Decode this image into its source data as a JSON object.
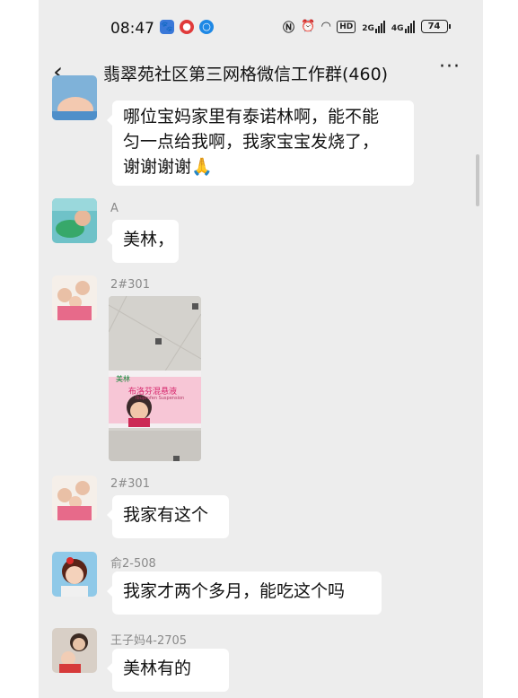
{
  "status_bar": {
    "time": "08:47",
    "battery": "74",
    "app_icons": [
      "baidu-icon",
      "weibo-icon",
      "qq-browser-icon"
    ],
    "signal_1_label": "2G",
    "signal_2_label": "4G",
    "hd_label": "HD"
  },
  "header": {
    "title": "翡翠苑社区第三网格微信工作群(460)",
    "back_icon": "chevron-left-icon",
    "more_icon": "more-icon"
  },
  "messages": [
    {
      "sender": "",
      "lines": [
        "哪位宝妈家里有泰诺林啊，能不能",
        "匀一点给我啊，我家宝宝发烧了，",
        "谢谢谢谢🙏"
      ]
    },
    {
      "sender": "A",
      "lines": [
        "美林，"
      ]
    },
    {
      "sender": "2#301",
      "type": "image"
    },
    {
      "sender": "2#301",
      "lines": [
        "我家有这个"
      ]
    },
    {
      "sender": "俞2-508",
      "lines": [
        "我家才两个多月，能吃这个吗"
      ]
    },
    {
      "sender": "王子妈4-2705",
      "lines": [
        "美林有的"
      ]
    }
  ],
  "photo": {
    "brand": "美林",
    "product": "布洛芬混悬液",
    "product_en": "Ibuprofen Suspension"
  },
  "colors": {
    "chat_background": "#ededed",
    "bubble": "#ffffff",
    "sender_text": "#8a8a8a"
  }
}
